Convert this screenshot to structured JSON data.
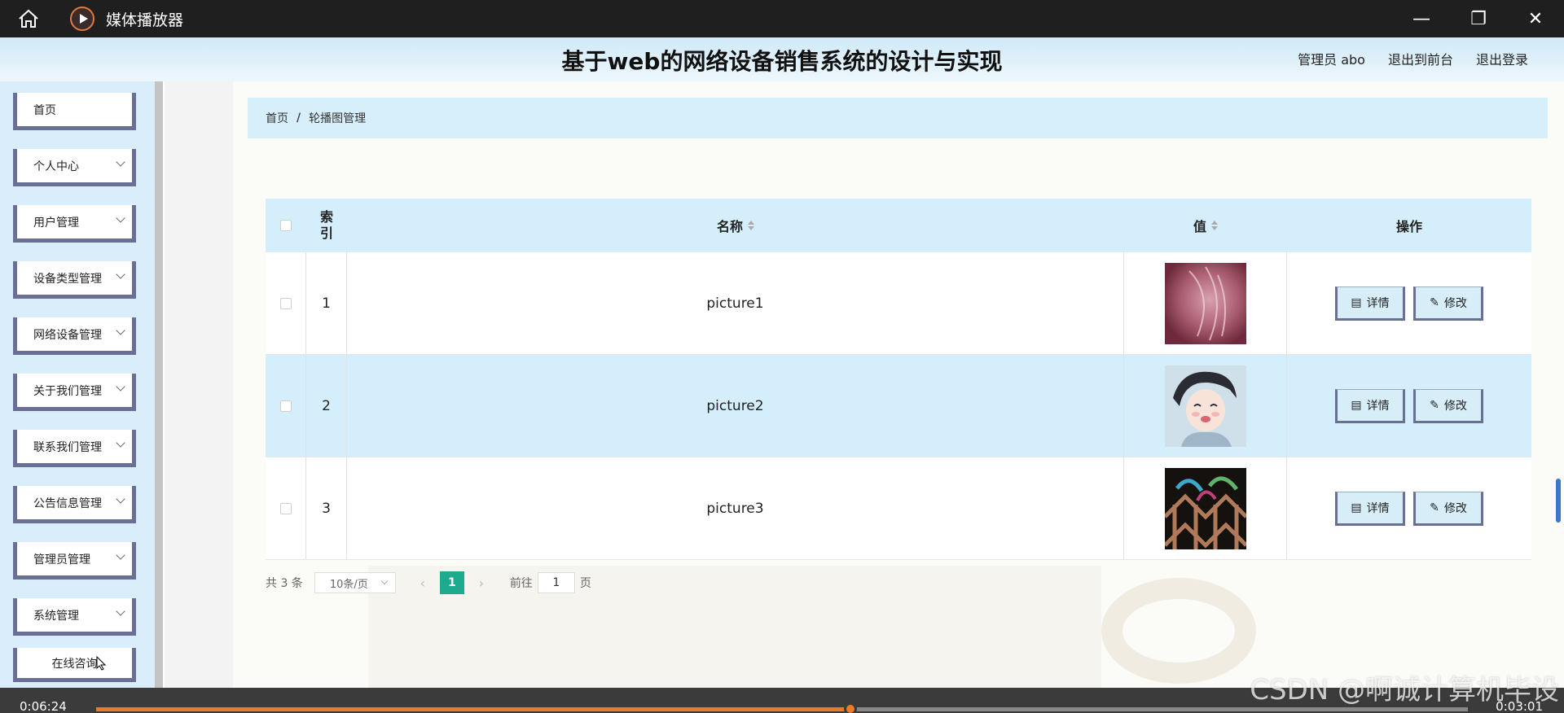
{
  "player": {
    "title": "媒体播放器",
    "controls": {
      "minimize": "—",
      "restore": "❐",
      "close": "✕"
    },
    "time_current": "0:06:24",
    "time_total": "0:03:01",
    "progress_fraction": 0.55
  },
  "app": {
    "title": "基于web的网络设备销售系统的设计与实现",
    "user_label": "管理员 abo",
    "front_link": "退出到前台",
    "logout_link": "退出登录"
  },
  "sidebar": {
    "items": [
      {
        "label": "首页",
        "chevron": false
      },
      {
        "label": "个人中心",
        "chevron": true
      },
      {
        "label": "用户管理",
        "chevron": true
      },
      {
        "label": "设备类型管理",
        "chevron": true
      },
      {
        "label": "网络设备管理",
        "chevron": true
      },
      {
        "label": "关于我们管理",
        "chevron": true
      },
      {
        "label": "联系我们管理",
        "chevron": true
      },
      {
        "label": "公告信息管理",
        "chevron": true
      },
      {
        "label": "管理员管理",
        "chevron": true
      },
      {
        "label": "系统管理",
        "chevron": true
      },
      {
        "label": "在线咨询",
        "chevron": false
      }
    ]
  },
  "breadcrumb": {
    "home": "首页",
    "sep": "/",
    "current": "轮播图管理"
  },
  "table": {
    "headers": {
      "index": "索引",
      "name": "名称",
      "value": "值",
      "actions": "操作"
    },
    "detail_label": "详情",
    "edit_label": "修改",
    "rows": [
      {
        "index": "1",
        "name": "picture1",
        "thumb": "pink-abstract"
      },
      {
        "index": "2",
        "name": "picture2",
        "thumb": "anime-girl"
      },
      {
        "index": "3",
        "name": "picture3",
        "thumb": "dark-lattice"
      }
    ]
  },
  "pagination": {
    "total": "共 3 条",
    "page_size": "10条/页",
    "current_page": "1",
    "goto_label": "前往",
    "goto_value": "1",
    "page_unit": "页"
  },
  "watermark": "CSDN @啊诚计算机毕设",
  "colors": {
    "accent": "#1eaa8e",
    "header_bg": "#d5eefb",
    "menu_border": "#6a6f96",
    "progress": "#f07a22"
  }
}
